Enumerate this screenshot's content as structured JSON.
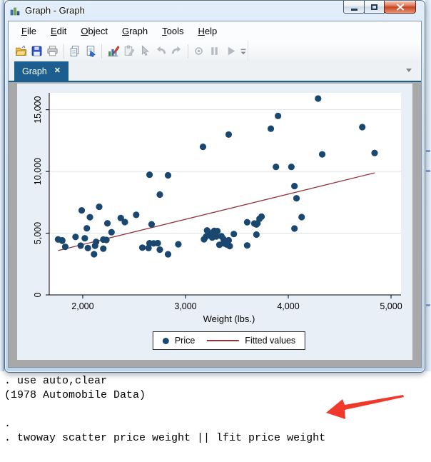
{
  "window": {
    "title": "Graph - Graph"
  },
  "menu_bar": {
    "items": [
      {
        "label": "File"
      },
      {
        "label": "Edit"
      },
      {
        "label": "Object"
      },
      {
        "label": "Graph"
      },
      {
        "label": "Tools"
      },
      {
        "label": "Help"
      }
    ]
  },
  "toolbar": {
    "buttons": [
      "open",
      "save",
      "print",
      "copy",
      "copy-to-document",
      "graph-editor",
      "rename",
      "pointer",
      "undo",
      "redo",
      "record",
      "pause",
      "play"
    ]
  },
  "tab_bar": {
    "active_tab": "Graph",
    "close_glyph": "✕"
  },
  "console": {
    "lines": [
      ". use auto,clear",
      "(1978 Automobile Data)",
      "",
      ".",
      ". twoway scatter price weight || lfit price weight"
    ]
  },
  "annotation": {
    "type": "red-arrow",
    "color": "#f0392b"
  },
  "colors": {
    "scatter_navy": "#1a476f",
    "fit_maroon": "#90353b",
    "tab_blue": "#1b5e8f",
    "chart_background": "#e9eff6",
    "plot_background": "#ffffff",
    "gridline": "#dce4ee",
    "letterbox_gray": "#a8a8a8"
  },
  "chart_data": {
    "type": "scatter",
    "title": "",
    "xlabel": "Weight (lbs.)",
    "ylabel": "",
    "x_ticks": [
      2000,
      3000,
      4000,
      5000
    ],
    "x_tick_labels": [
      "2,000",
      "3,000",
      "4,000",
      "5,000"
    ],
    "y_ticks": [
      0,
      5000,
      10000,
      15000
    ],
    "y_tick_labels": [
      "0",
      "5,000",
      "10,000",
      "15,000"
    ],
    "x_domain": [
      1674,
      5097
    ],
    "y_domain": [
      0,
      16370
    ],
    "grid": "horizontal-y-ticks",
    "legend": {
      "position": "bottom-center",
      "entries": [
        {
          "label": "Price",
          "type": "marker",
          "color": "#1a476f"
        },
        {
          "label": "Fitted values",
          "type": "line",
          "color": "#90353b"
        }
      ]
    },
    "series": [
      {
        "name": "Price",
        "type": "scatter",
        "color": "#1a476f",
        "points": [
          [
            2930,
            4099
          ],
          [
            3350,
            4749
          ],
          [
            2640,
            3799
          ],
          [
            3250,
            4816
          ],
          [
            4080,
            7827
          ],
          [
            3670,
            5788
          ],
          [
            2230,
            4453
          ],
          [
            3280,
            5189
          ],
          [
            3880,
            10372
          ],
          [
            3400,
            4082
          ],
          [
            4330,
            11385
          ],
          [
            3900,
            14500
          ],
          [
            4290,
            15906
          ],
          [
            2110,
            3299
          ],
          [
            3690,
            5705
          ],
          [
            3180,
            4504
          ],
          [
            3220,
            5104
          ],
          [
            2750,
            3667
          ],
          [
            3430,
            3955
          ],
          [
            2120,
            3984
          ],
          [
            3600,
            4010
          ],
          [
            3600,
            5886
          ],
          [
            3740,
            6342
          ],
          [
            1800,
            4389
          ],
          [
            2650,
            4187
          ],
          [
            4840,
            11497
          ],
          [
            4720,
            13594
          ],
          [
            3830,
            13466
          ],
          [
            2580,
            3829
          ],
          [
            4060,
            5379
          ],
          [
            3720,
            6165
          ],
          [
            3370,
            4516
          ],
          [
            4130,
            6303
          ],
          [
            2830,
            3291
          ],
          [
            4060,
            8814
          ],
          [
            3310,
            5172
          ],
          [
            3300,
            4733
          ],
          [
            3690,
            4890
          ],
          [
            3370,
            4181
          ],
          [
            2730,
            4195
          ],
          [
            4030,
            10371
          ],
          [
            3260,
            4647
          ],
          [
            1800,
            4425
          ],
          [
            2200,
            4482
          ],
          [
            2520,
            6486
          ],
          [
            3330,
            4060
          ],
          [
            3700,
            5798
          ],
          [
            3470,
            4934
          ],
          [
            3210,
            5222
          ],
          [
            3200,
            4723
          ],
          [
            3420,
            4424
          ],
          [
            2690,
            4172
          ],
          [
            2830,
            9690
          ],
          [
            2070,
            6295
          ],
          [
            2650,
            9735
          ],
          [
            2370,
            6229
          ],
          [
            2020,
            4589
          ],
          [
            2280,
            5079
          ],
          [
            2750,
            8129
          ],
          [
            2130,
            4296
          ],
          [
            2240,
            5799
          ],
          [
            1760,
            4499
          ],
          [
            1980,
            3995
          ],
          [
            3420,
            12990
          ],
          [
            1830,
            3895
          ],
          [
            2050,
            3798
          ],
          [
            2410,
            5899
          ],
          [
            2200,
            3748
          ],
          [
            2670,
            5719
          ],
          [
            2160,
            7140
          ],
          [
            2040,
            5397
          ],
          [
            1930,
            4697
          ],
          [
            1990,
            6850
          ],
          [
            3170,
            11995
          ]
        ]
      },
      {
        "name": "Fitted values",
        "type": "line",
        "color": "#90353b",
        "points": [
          [
            1760,
            3591
          ],
          [
            4840,
            9887
          ]
        ]
      }
    ]
  }
}
